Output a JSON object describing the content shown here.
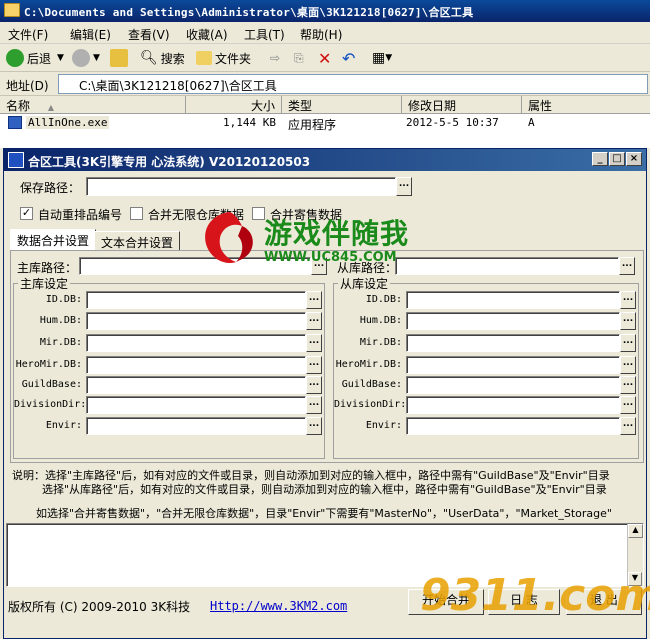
{
  "explorer": {
    "title": "C:\\Documents and Settings\\Administrator\\桌面\\3K121218[0627]\\合区工具",
    "menu": [
      "文件(F)",
      "编辑(E)",
      "查看(V)",
      "收藏(A)",
      "工具(T)",
      "帮助(H)"
    ],
    "toolbar": {
      "back": "后退",
      "search": "搜索",
      "folders": "文件夹"
    },
    "address_label": "地址(D)",
    "address_value": "C:\\桌面\\3K121218[0627]\\合区工具",
    "columns": [
      "名称",
      "大小",
      "类型",
      "修改日期",
      "属性"
    ],
    "files": [
      {
        "name": "AllInOne.exe",
        "size": "1,144 KB",
        "type": "应用程序",
        "modified": "2012-5-5 10:37",
        "attr": "A"
      }
    ]
  },
  "app": {
    "title": "合区工具(3K引擎专用 心法系统) V20120120503",
    "save_path_label": "保存路径：",
    "browse_label": "...",
    "checkboxes": [
      {
        "label": "自动重排品编号",
        "checked": true
      },
      {
        "label": "合并无限仓库数据",
        "checked": false
      },
      {
        "label": "合并寄售数据",
        "checked": false
      }
    ],
    "tabs": [
      "数据合并设置",
      "文本合并设置"
    ],
    "main_path_label": "主库路径：",
    "sub_path_label": "从库路径：",
    "main_group": "主库设定",
    "sub_group": "从库设定",
    "fields": [
      "ID.DB:",
      "Hum.DB:",
      "Mir.DB:",
      "HeroMir.DB:",
      "GuildBase:",
      "DivisionDir:",
      "Envir:"
    ],
    "notes": [
      "说明：选择\"主库路径\"后，如有对应的文件或目录，则自动添加到对应的输入框中，路径中需有\"GuildBase\"及\"Envir\"目录",
      "选择\"从库路径\"后，如有对应的文件或目录，则自动添加到对应的输入框中，路径中需有\"GuildBase\"及\"Envir\"目录",
      "如选择\"合并寄售数据\"，\"合并无限仓库数据\"，目录\"Envir\"下需要有\"MasterNo\"，\"UserData\"，\"Market_Storage\""
    ],
    "copyright": "版权所有 (C) 2009-2010 3K科技",
    "link": "Http://www.3KM2.com",
    "buttons": {
      "start": "开始合并",
      "log": "日 志",
      "exit": "退 出"
    }
  },
  "watermarks": {
    "logo_name": "游戏伴随我",
    "logo_url": "WWW.UC845.COM",
    "corner": "9311.com"
  }
}
